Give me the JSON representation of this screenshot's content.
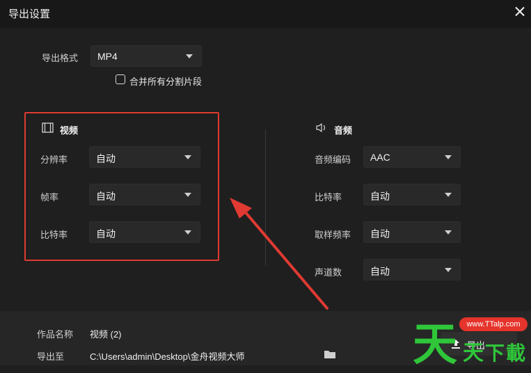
{
  "window": {
    "title": "导出设置",
    "close_icon": "close-icon"
  },
  "format": {
    "label": "导出格式",
    "value": "MP4"
  },
  "merge": {
    "label": "合并所有分割片段",
    "checked": false
  },
  "video": {
    "title": "视频",
    "icon": "film-icon",
    "fields": [
      {
        "label": "分辨率",
        "value": "自动"
      },
      {
        "label": "帧率",
        "value": "自动"
      },
      {
        "label": "比特率",
        "value": "自动"
      }
    ]
  },
  "audio": {
    "title": "音频",
    "icon": "speaker-icon",
    "fields": [
      {
        "label": "音频编码",
        "value": "AAC"
      },
      {
        "label": "比特率",
        "value": "自动"
      },
      {
        "label": "取样频率",
        "value": "自动"
      },
      {
        "label": "声道数",
        "value": "自动"
      }
    ]
  },
  "footer": {
    "name_label": "作品名称",
    "name_value": "视频 (2)",
    "path_label": "导出至",
    "path_value": "C:\\Users\\admin\\Desktop\\金舟视频大师",
    "folder_icon": "folder-icon",
    "export_icon": "upload-icon",
    "export_label": "导出"
  },
  "watermark": {
    "site": "www.TTalp.com",
    "chars": [
      "天",
      "天",
      "下",
      "載"
    ]
  },
  "colors": {
    "highlight_border": "#e03a32",
    "watermark_green": "#2fc63a",
    "watermark_red": "#e5342b"
  }
}
